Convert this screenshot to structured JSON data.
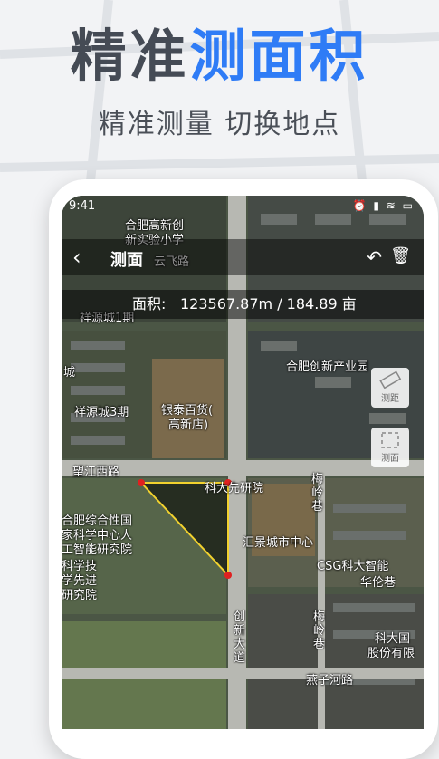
{
  "promo": {
    "headline_dark": "精准",
    "headline_blue": "测面积",
    "subtitle": "精准测量 切换地点"
  },
  "status_bar": {
    "time": "9:41",
    "icons": [
      "alarm-icon",
      "signal-icon",
      "wifi-icon",
      "battery-icon"
    ]
  },
  "toolbar": {
    "back_icon": "‹",
    "title": "测面",
    "undo_icon": "↶",
    "trash_icon": "🗑"
  },
  "measure": {
    "area_label": "面积:",
    "area_value": "123567.87m / 184.89 亩"
  },
  "side_tools": [
    {
      "name": "ruler-tool",
      "label": "测距"
    },
    {
      "name": "area-tool",
      "label": "测面"
    }
  ],
  "map_labels": {
    "school_1": "合肥高新创",
    "school_2": "新实验小学",
    "yunfei_road": "云飞路",
    "xiangyuan_city": "祥源城1期",
    "cheng": "城",
    "xiangyuan_3": "祥源城3期",
    "yintai_1": "银泰百货(",
    "yintai_2": "高新店)",
    "chuangxin_park": "合肥创新产业园",
    "wangjiang_road": "望江西路",
    "keda_institute": "科大先研院",
    "meiling_lane": "梅岭巷",
    "meiling_lane_2": "梅岭巷",
    "national_center_1": "合肥综合性国",
    "national_center_2": "家科学中心人",
    "national_center_3": "工智能研究院",
    "advanced_1": "科学技",
    "advanced_2": "学先进",
    "advanced_3": "研究院",
    "huijing_center": "汇景城市中心",
    "csg": "CSG科大智能",
    "huajing_lane": "华伦巷",
    "chuangxin_avenue": "创新大道",
    "keda_shares_1": "科大国",
    "keda_shares_2": "股份有限",
    "yanzihe_road": "燕子河路"
  },
  "colors": {
    "accent_blue": "#2f7cf6",
    "headline_dark": "#454b55",
    "polygon_edge": "#f2d22e",
    "vertex": "#e02020"
  }
}
